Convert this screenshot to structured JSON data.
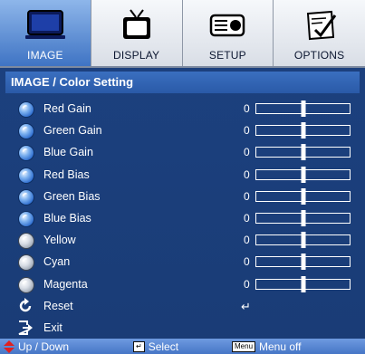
{
  "tabs": [
    {
      "label": "IMAGE",
      "icon": "monitor-icon",
      "active": true
    },
    {
      "label": "DISPLAY",
      "icon": "tv-icon",
      "active": false
    },
    {
      "label": "SETUP",
      "icon": "projector-icon",
      "active": false
    },
    {
      "label": "OPTIONS",
      "icon": "options-icon",
      "active": false
    }
  ],
  "header": {
    "title": "IMAGE / Color Setting"
  },
  "rows": [
    {
      "label": "Red Gain",
      "value": "0",
      "level": 0.5,
      "bullet": "blue"
    },
    {
      "label": "Green Gain",
      "value": "0",
      "level": 0.5,
      "bullet": "blue"
    },
    {
      "label": "Blue Gain",
      "value": "0",
      "level": 0.5,
      "bullet": "blue"
    },
    {
      "label": "Red Bias",
      "value": "0",
      "level": 0.5,
      "bullet": "blue"
    },
    {
      "label": "Green Bias",
      "value": "0",
      "level": 0.5,
      "bullet": "blue"
    },
    {
      "label": "Blue Bias",
      "value": "0",
      "level": 0.5,
      "bullet": "blue"
    },
    {
      "label": "Yellow",
      "value": "0",
      "level": 0.5,
      "bullet": "grey"
    },
    {
      "label": "Cyan",
      "value": "0",
      "level": 0.5,
      "bullet": "grey"
    },
    {
      "label": "Magenta",
      "value": "0",
      "level": 0.5,
      "bullet": "grey"
    }
  ],
  "reset": {
    "label": "Reset",
    "enter_symbol": "↵"
  },
  "exit": {
    "label": "Exit"
  },
  "footer": {
    "updown_label": "Up / Down",
    "select_key": "↵",
    "select_label": "Select",
    "menu_key": "Menu",
    "menu_label": "Menu off"
  },
  "colors": {
    "accent": "#3f74c4",
    "background": "#1c4180",
    "footer": "#5a88d4"
  }
}
